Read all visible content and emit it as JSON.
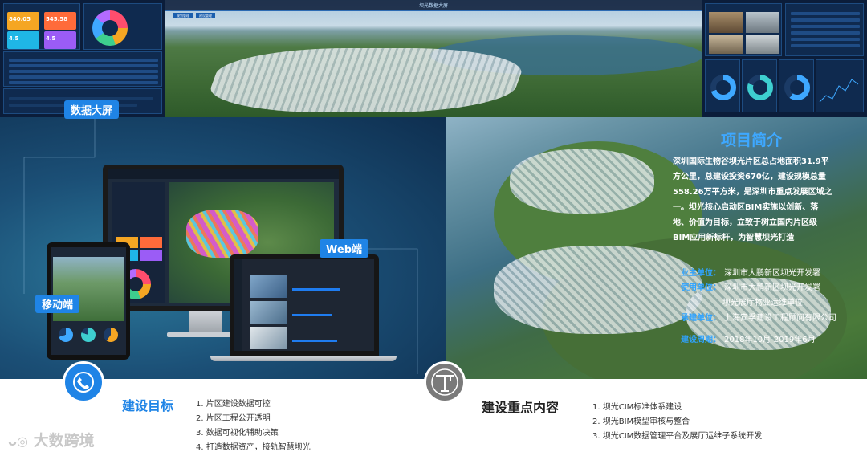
{
  "top": {
    "title": "坝光数据大屏",
    "tabs": [
      "规划管理",
      "建设管理"
    ],
    "kpis": [
      {
        "label": "",
        "value": "840.05",
        "color": "#f5a623"
      },
      {
        "label": "",
        "value": "545.58",
        "color": "#ff6b3a"
      },
      {
        "label": "",
        "value": "4.5",
        "color": "#1fb6e6"
      },
      {
        "label": "",
        "value": "4.5",
        "color": "#9b5cf6"
      }
    ]
  },
  "hero": {
    "label_dashboard": "数据大屏",
    "label_web": "Web端",
    "label_mobile": "移动端"
  },
  "intro": {
    "title": "项目简介",
    "body": "深圳国际生物谷坝光片区总占地面积31.9平方公里，总建设投资670亿，建设规模总量558.26万平方米，是深圳市重点发展区域之一。坝光核心启动区BIM实施以创新、落地、价值为目标，立致于树立国内片区级BIM应用新标杆，为智慧坝光打造",
    "owner_key": "业主单位：",
    "owner_val": "深圳市大鹏新区坝光开发署",
    "user_key": "使用单位：",
    "user_val": "深圳市大鹏新区坝光开发署",
    "user_val2": "坝光展厅物业运维单位",
    "contractor_key": "承建单位：",
    "contractor_val": "上海宾孚建设工程顾问有限公司",
    "period_key": "建设周期：",
    "period_val": "2018年10月-2019年6月"
  },
  "goals": {
    "title": "建设目标",
    "items": [
      "1. 片区建设数据可控",
      "2. 片区工程公开透明",
      "3. 数据可视化辅助决策",
      "4. 打造数据资产，接轨智慧坝光"
    ]
  },
  "key": {
    "title": "建设重点内容",
    "items": [
      "1. 坝光CIM标准体系建设",
      "2. 坝光BIM模型审核与整合",
      "3. 坝光CIM数据管理平台及展厅运维子系统开发"
    ]
  },
  "watermark": "大数跨境",
  "colors": {
    "accent": "#1f84e6",
    "title_blue": "#3ea8ff",
    "dark": "#0b1d3a"
  }
}
